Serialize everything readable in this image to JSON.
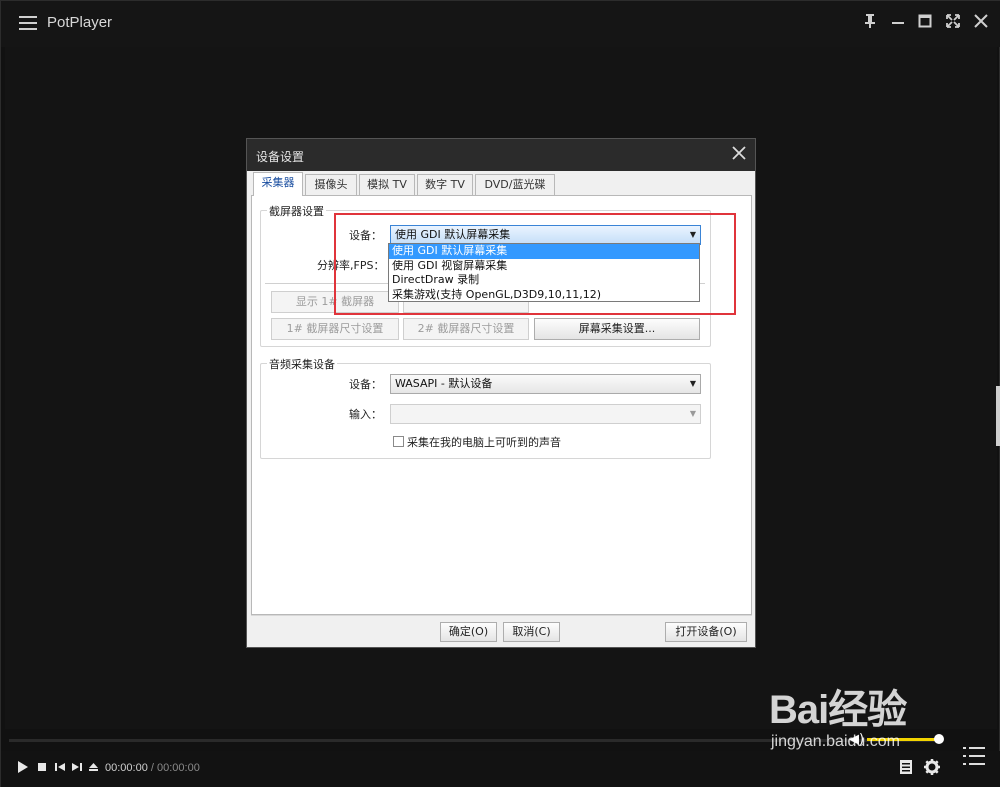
{
  "app": {
    "title": "PotPlayer"
  },
  "player": {
    "time_current": "00:00:00",
    "time_sep": "/",
    "time_total": "00:00:00"
  },
  "dialog": {
    "title": "设备设置",
    "tabs": [
      "采集器",
      "摄像头",
      "模拟 TV",
      "数字 TV",
      "DVD/蓝光碟"
    ],
    "screen_group": {
      "label": "截屏器设置",
      "device_label": "设备：",
      "device_value": "使用 GDI 默认屏幕采集",
      "resolution_label": "分辨率,FPS：",
      "dropdown_options": [
        "使用 GDI 默认屏幕采集",
        "使用 GDI 视窗屏幕采集",
        "DirectDraw 录制",
        "采集游戏(支持 OpenGL,D3D9,10,11,12)"
      ],
      "btn_show1": "显示 1# 截屏器",
      "btn_size1": "1# 截屏器尺寸设置",
      "btn_size2": "2# 截屏器尺寸设置",
      "btn_capture_settings": "屏幕采集设置..."
    },
    "audio_group": {
      "label": "音频采集设备",
      "device_label": "设备：",
      "device_value": "WASAPI - 默认设备",
      "input_label": "输入：",
      "input_value": "",
      "checkbox_label": "采集在我的电脑上可听到的声音"
    },
    "footer": {
      "ok": "确定(O)",
      "cancel": "取消(C)",
      "open_device": "打开设备(O)"
    }
  },
  "watermark": {
    "main": "Bai经验",
    "sub": "jingyan.baidu.com"
  },
  "colors": {
    "highlight_box": "#e0343b",
    "volume": "#f2d400",
    "selected": "#3399ff"
  }
}
